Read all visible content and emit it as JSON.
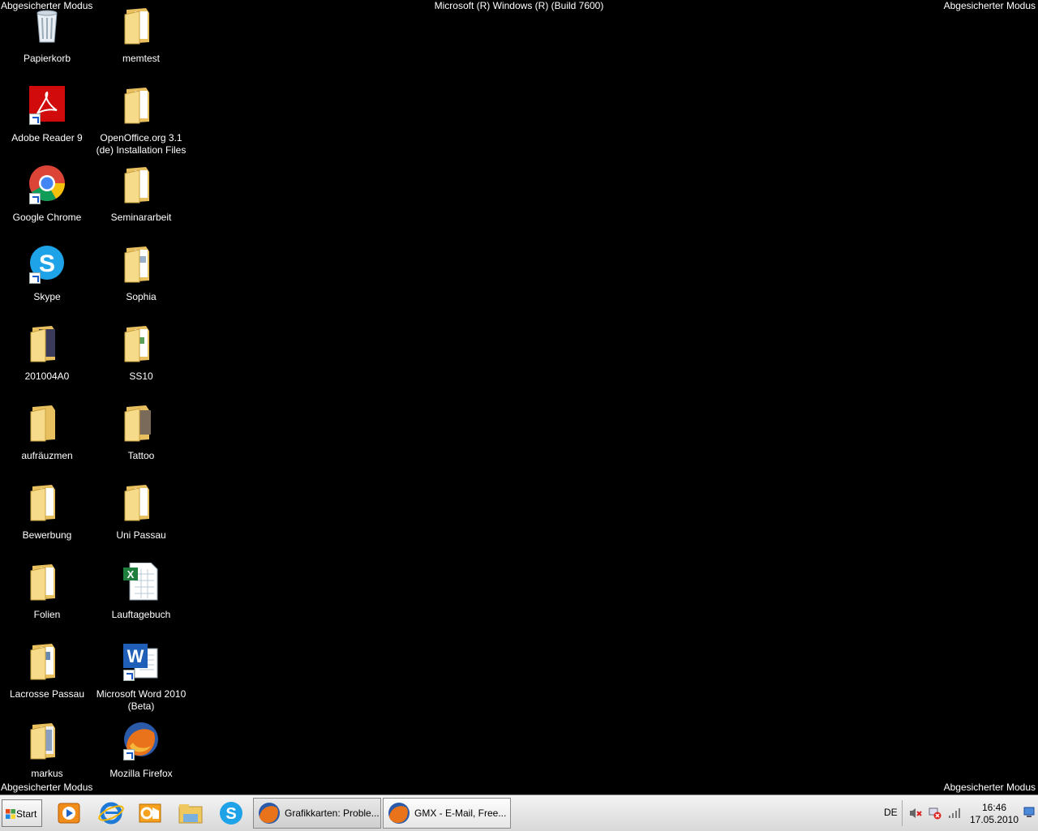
{
  "safe_mode": {
    "top_left": "Abgesicherter Modus",
    "top_center": "Microsoft (R) Windows (R) (Build 7600)",
    "top_right": "Abgesicherter Modus",
    "bottom_left": "Abgesicherter Modus",
    "bottom_right": "Abgesicherter Modus"
  },
  "desktop": {
    "icons": [
      {
        "label": "Papierkorb",
        "icon": "recycle-bin-icon"
      },
      {
        "label": "memtest",
        "icon": "folder-icon"
      },
      {
        "label": "Adobe Reader 9",
        "icon": "adobe-reader-icon"
      },
      {
        "label": "OpenOffice.org 3.1 (de) Installation Files",
        "icon": "folder-icon"
      },
      {
        "label": "Google Chrome",
        "icon": "chrome-icon"
      },
      {
        "label": "Seminararbeit",
        "icon": "folder-icon"
      },
      {
        "label": "Skype",
        "icon": "skype-icon"
      },
      {
        "label": "Sophia",
        "icon": "folder-icon"
      },
      {
        "label": "201004A0",
        "icon": "folder-icon"
      },
      {
        "label": "SS10",
        "icon": "folder-icon"
      },
      {
        "label": "aufräuzmen",
        "icon": "folder-icon"
      },
      {
        "label": "Tattoo",
        "icon": "folder-icon"
      },
      {
        "label": "Bewerbung",
        "icon": "folder-icon"
      },
      {
        "label": "Uni Passau",
        "icon": "folder-icon"
      },
      {
        "label": "Folien",
        "icon": "folder-icon"
      },
      {
        "label": "Lauftagebuch",
        "icon": "excel-file-icon"
      },
      {
        "label": "Lacrosse Passau",
        "icon": "folder-icon"
      },
      {
        "label": "Microsoft Word 2010 (Beta)",
        "icon": "word-icon"
      },
      {
        "label": "markus",
        "icon": "folder-icon"
      },
      {
        "label": "Mozilla Firefox",
        "icon": "firefox-icon"
      }
    ]
  },
  "taskbar": {
    "start_label": "Start",
    "quick_launch": [
      "media-player-icon",
      "internet-explorer-icon",
      "outlook-icon",
      "explorer-icon",
      "skype-icon"
    ],
    "tasks": [
      {
        "label": "Grafikkarten: Proble...",
        "icon": "firefox-icon"
      },
      {
        "label": "GMX - E-Mail, Free...",
        "icon": "firefox-icon"
      }
    ],
    "language": "DE",
    "tray_icons": [
      "volume-muted-icon",
      "network-error-icon",
      "signal-icon"
    ],
    "time": "16:46",
    "date": "17.05.2010"
  },
  "colors": {
    "desktop_background": "#000000",
    "folder": "#f2d27a",
    "taskbar": "#e4e4e4"
  }
}
